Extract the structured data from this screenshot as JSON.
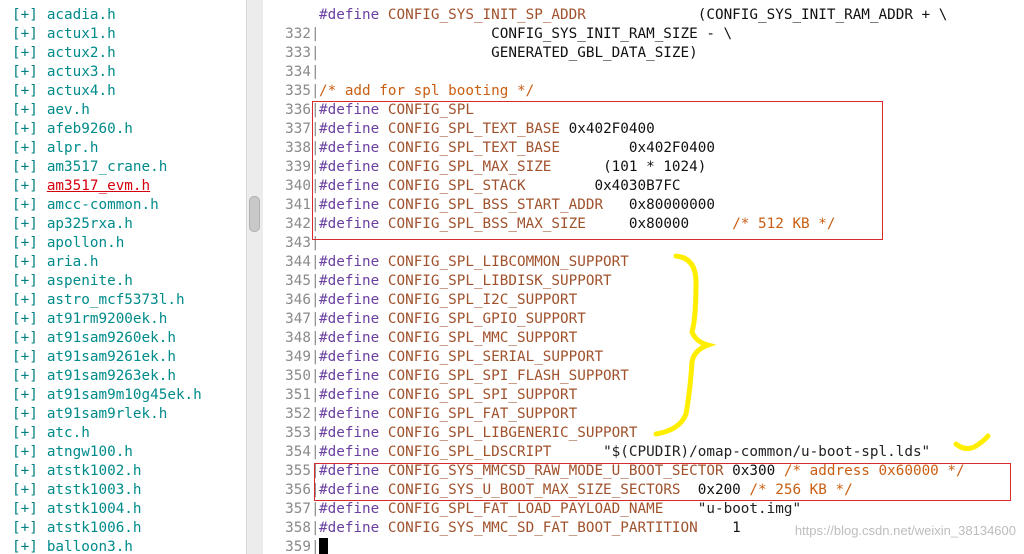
{
  "file_tree": {
    "bullet": "[+]",
    "items": [
      {
        "name": "acadia.h"
      },
      {
        "name": "actux1.h"
      },
      {
        "name": "actux2.h"
      },
      {
        "name": "actux3.h"
      },
      {
        "name": "actux4.h"
      },
      {
        "name": "aev.h"
      },
      {
        "name": "afeb9260.h"
      },
      {
        "name": "alpr.h"
      },
      {
        "name": "am3517_crane.h"
      },
      {
        "name": "am3517_evm.h",
        "selected": true
      },
      {
        "name": "amcc-common.h"
      },
      {
        "name": "ap325rxa.h"
      },
      {
        "name": "apollon.h"
      },
      {
        "name": "aria.h"
      },
      {
        "name": "aspenite.h"
      },
      {
        "name": "astro_mcf5373l.h"
      },
      {
        "name": "at91rm9200ek.h"
      },
      {
        "name": "at91sam9260ek.h"
      },
      {
        "name": "at91sam9261ek.h"
      },
      {
        "name": "at91sam9263ek.h"
      },
      {
        "name": "at91sam9m10g45ek.h"
      },
      {
        "name": "at91sam9rlek.h"
      },
      {
        "name": "atc.h"
      },
      {
        "name": "atngw100.h"
      },
      {
        "name": "atstk1002.h"
      },
      {
        "name": "atstk1003.h"
      },
      {
        "name": "atstk1004.h"
      },
      {
        "name": "atstk1006.h"
      },
      {
        "name": "balloon3.h"
      }
    ]
  },
  "editor": {
    "lines": [
      {
        "ln": "",
        "text": "#define CONFIG_SYS_INIT_SP_ADDR             (CONFIG_SYS_INIT_RAM_ADDR + \\"
      },
      {
        "ln": "332",
        "text": "                    CONFIG_SYS_INIT_RAM_SIZE - \\"
      },
      {
        "ln": "333",
        "text": "                    GENERATED_GBL_DATA_SIZE)"
      },
      {
        "ln": "334",
        "text": ""
      },
      {
        "ln": "335",
        "text": "/* add for spl booting */"
      },
      {
        "ln": "336",
        "text": "#define CONFIG_SPL"
      },
      {
        "ln": "337",
        "text": "#define CONFIG_SPL_TEXT_BASE 0x402F0400"
      },
      {
        "ln": "338",
        "text": "#define CONFIG_SPL_TEXT_BASE        0x402F0400"
      },
      {
        "ln": "339",
        "text": "#define CONFIG_SPL_MAX_SIZE      (101 * 1024)"
      },
      {
        "ln": "340",
        "text": "#define CONFIG_SPL_STACK        0x4030B7FC"
      },
      {
        "ln": "341",
        "text": "#define CONFIG_SPL_BSS_START_ADDR   0x80000000"
      },
      {
        "ln": "342",
        "text": "#define CONFIG_SPL_BSS_MAX_SIZE     0x80000     /* 512 KB */"
      },
      {
        "ln": "343",
        "text": ""
      },
      {
        "ln": "344",
        "text": "#define CONFIG_SPL_LIBCOMMON_SUPPORT"
      },
      {
        "ln": "345",
        "text": "#define CONFIG_SPL_LIBDISK_SUPPORT"
      },
      {
        "ln": "346",
        "text": "#define CONFIG_SPL_I2C_SUPPORT"
      },
      {
        "ln": "347",
        "text": "#define CONFIG_SPL_GPIO_SUPPORT"
      },
      {
        "ln": "348",
        "text": "#define CONFIG_SPL_MMC_SUPPORT"
      },
      {
        "ln": "349",
        "text": "#define CONFIG_SPL_SERIAL_SUPPORT"
      },
      {
        "ln": "350",
        "text": "#define CONFIG_SPL_SPI_FLASH_SUPPORT"
      },
      {
        "ln": "351",
        "text": "#define CONFIG_SPL_SPI_SUPPORT"
      },
      {
        "ln": "352",
        "text": "#define CONFIG_SPL_FAT_SUPPORT"
      },
      {
        "ln": "353",
        "text": "#define CONFIG_SPL_LIBGENERIC_SUPPORT"
      },
      {
        "ln": "354",
        "text": "#define CONFIG_SPL_LDSCRIPT      \"$(CPUDIR)/omap-common/u-boot-spl.lds\""
      },
      {
        "ln": "355",
        "text": "#define CONFIG_SYS_MMCSD_RAW_MODE_U_BOOT_SECTOR 0x300 /* address 0x60000 */"
      },
      {
        "ln": "356",
        "text": "#define CONFIG_SYS_U_BOOT_MAX_SIZE_SECTORS  0x200 /* 256 KB */"
      },
      {
        "ln": "357",
        "text": "#define CONFIG_SPL_FAT_LOAD_PAYLOAD_NAME    \"u-boot.img\""
      },
      {
        "ln": "358",
        "text": "#define CONFIG_SYS_MMC_SD_FAT_BOOT_PARTITION    1"
      },
      {
        "ln": "359",
        "text": "",
        "cursor": true
      }
    ]
  },
  "watermark": "https://blog.csdn.net/weixin_38134600",
  "colors": {
    "preprocessor": "#6a3fa0",
    "macro": "#a0522d",
    "comment": "#ca5e12",
    "tree_bullet": "#008080",
    "tree_name": "#008b8b",
    "selected_file": "#d7000f",
    "annotation_box": "#d82a2a",
    "annotation_brace": "#ffee00"
  }
}
